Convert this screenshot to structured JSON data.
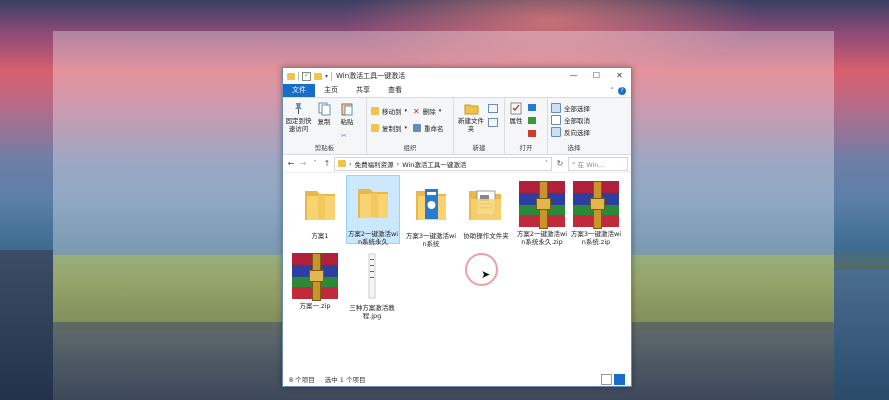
{
  "window": {
    "title": "Win激活工具一键激活",
    "controls": {
      "minimize": "—",
      "maximize": "☐",
      "close": "✕"
    }
  },
  "menu": {
    "tabs": [
      "文件",
      "主页",
      "共享",
      "查看"
    ]
  },
  "ribbon": {
    "clipboard": {
      "label": "剪贴板",
      "pin": "固定到快速访问",
      "copy": "复制",
      "paste": "粘贴"
    },
    "organize": {
      "label": "组织",
      "move_to": "移动到",
      "copy_to": "复制到",
      "delete": "删除",
      "rename": "重命名"
    },
    "new": {
      "label": "新建",
      "new_folder": "新建文件夹"
    },
    "open": {
      "label": "打开",
      "properties": "属性"
    },
    "select": {
      "label": "选择",
      "select_all": "全部选择",
      "select_none": "全部取消",
      "invert": "反向选择"
    }
  },
  "address": {
    "path": [
      "免费福利资源",
      "Win激活工具一键激活"
    ],
    "search_placeholder": "在 Win..."
  },
  "files": [
    {
      "name": "方案1",
      "type": "folder",
      "selected": false
    },
    {
      "name": "方案2一键激活win系统永久",
      "type": "folder",
      "selected": true
    },
    {
      "name": "方案3一键激活win系统",
      "type": "folder-blue",
      "selected": false
    },
    {
      "name": "协助操作文件夹",
      "type": "folder-doc",
      "selected": false
    },
    {
      "name": "方案2一键激活win系统永久.zip",
      "type": "rar",
      "selected": false
    },
    {
      "name": "方案3一键激活win系统.zip",
      "type": "rar",
      "selected": false
    },
    {
      "name": "方案一.zip",
      "type": "rar",
      "selected": false
    },
    {
      "name": "三种方案激活教程.jpg",
      "type": "image",
      "selected": false
    }
  ],
  "status": {
    "count": "8 个项目",
    "selected": "选中 1 个项目"
  }
}
